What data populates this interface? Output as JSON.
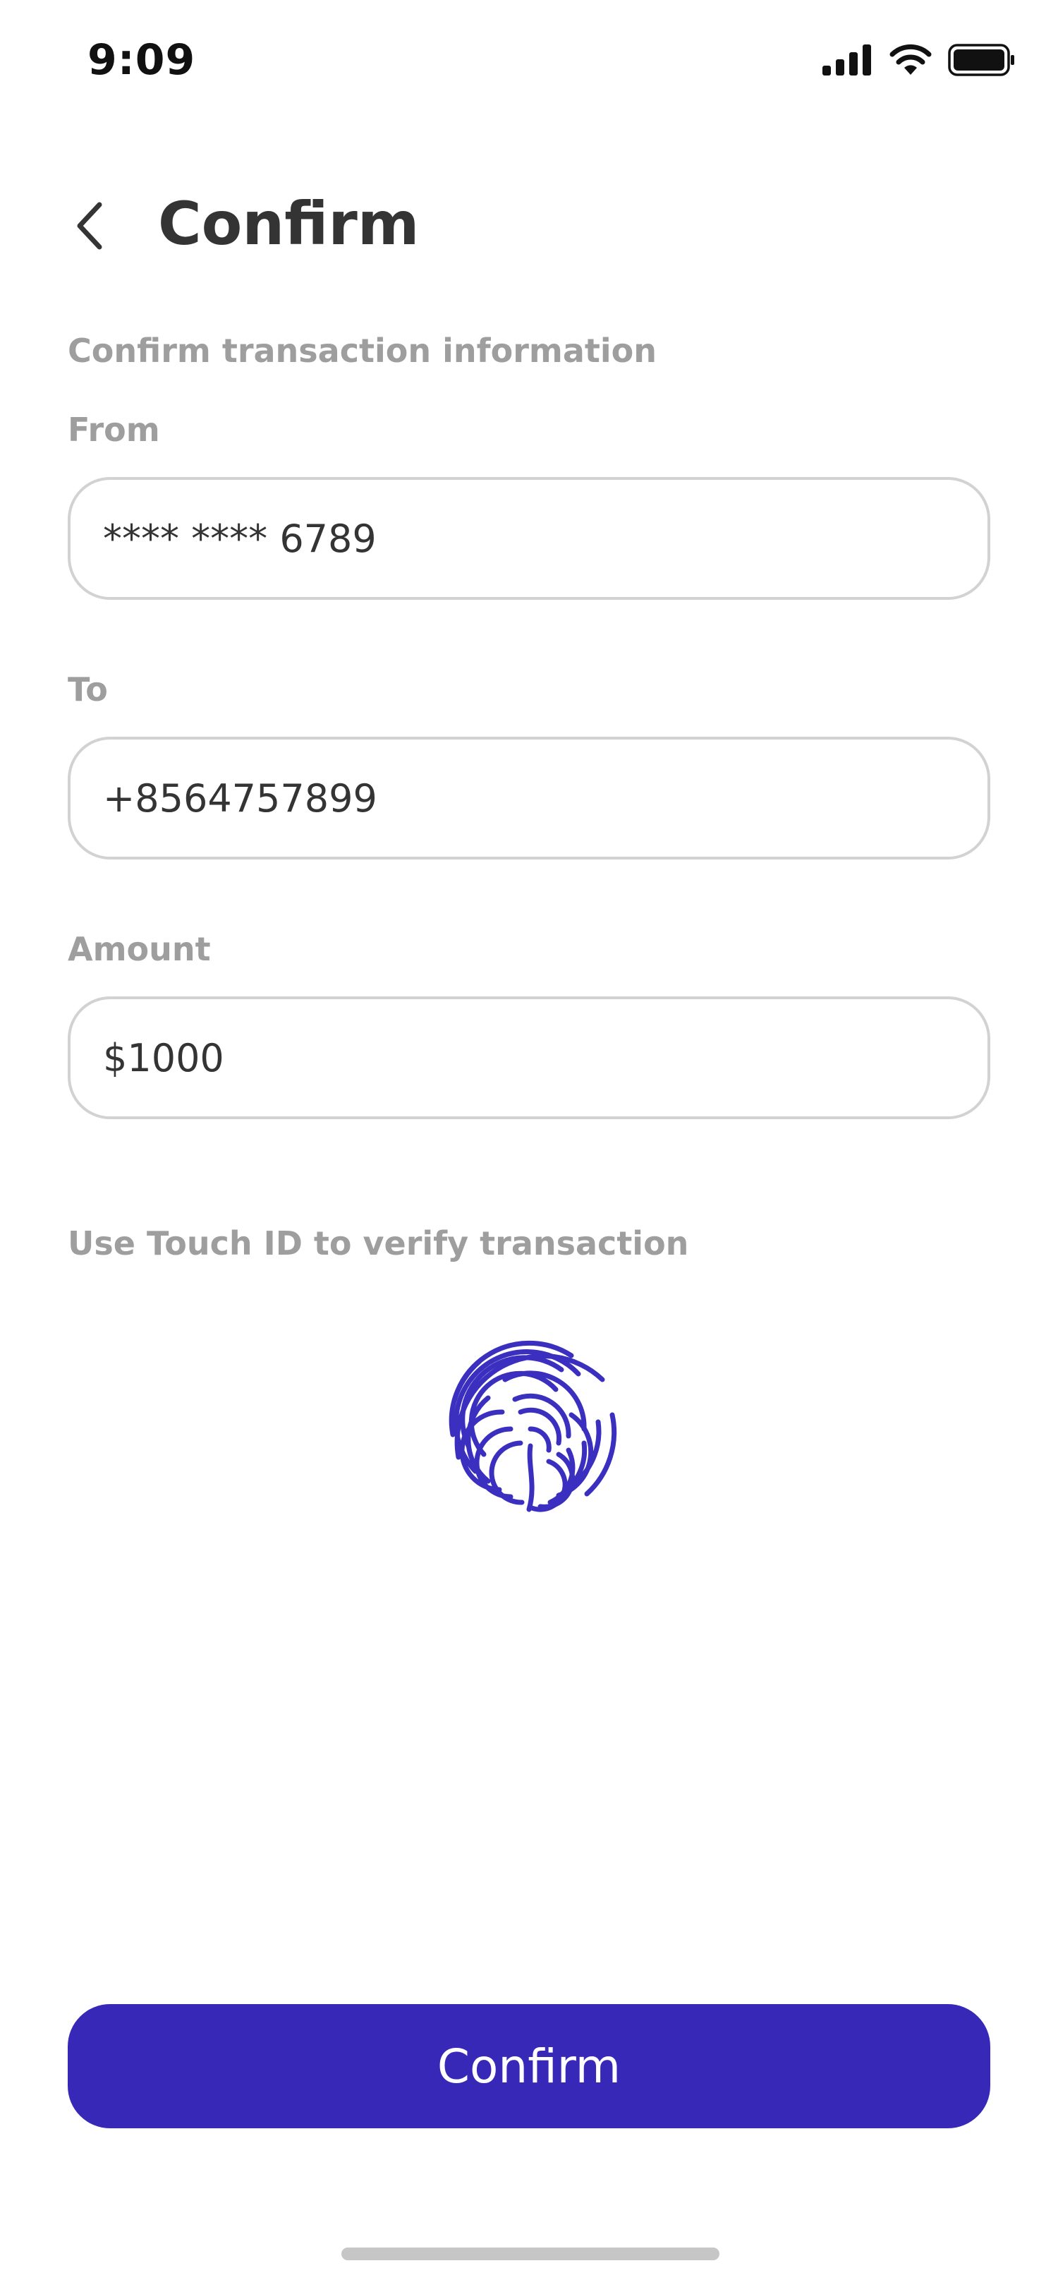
{
  "status_bar": {
    "time": "9:09",
    "icons": [
      "signal-icon",
      "wifi-icon",
      "battery-icon"
    ]
  },
  "header": {
    "title": "Confirm",
    "back_icon": "chevron-left-icon"
  },
  "form": {
    "section_title": "Confirm transaction information",
    "from": {
      "label": "From",
      "value": "**** **** 6789"
    },
    "to": {
      "label": "To",
      "value": "+8564757899"
    },
    "amount": {
      "label": "Amount",
      "value": "$1000"
    }
  },
  "touch_id": {
    "prompt": "Use Touch ID to verify transaction",
    "icon": "fingerprint-icon"
  },
  "actions": {
    "confirm_label": "Confirm"
  },
  "colors": {
    "accent": "#3728b7",
    "fingerprint": "#3b2fc0",
    "label_gray": "#9e9e9e",
    "text": "#343434",
    "border": "#d2d2d2"
  }
}
